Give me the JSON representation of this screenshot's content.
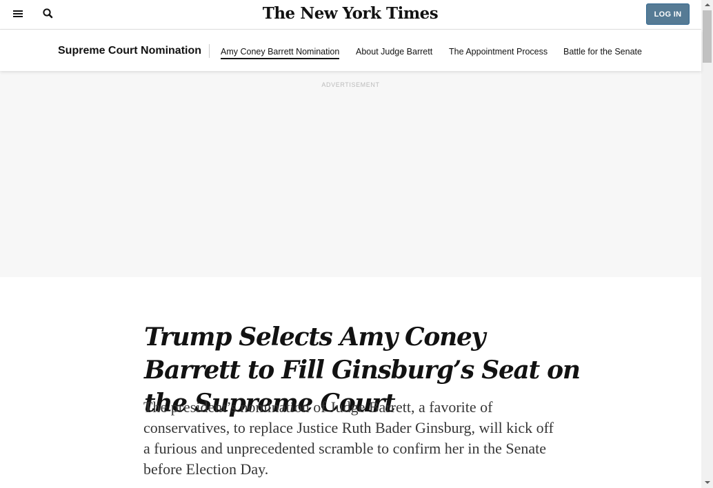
{
  "header": {
    "logo": "The New York Times",
    "login_label": "LOG IN",
    "menu_icon": "hamburger-menu-icon",
    "search_icon": "search-icon"
  },
  "section_nav": {
    "title": "Supreme Court Nomination",
    "links": [
      {
        "label": "Amy Coney Barrett Nomination",
        "active": true
      },
      {
        "label": "About Judge Barrett",
        "active": false
      },
      {
        "label": "The Appointment Process",
        "active": false
      },
      {
        "label": "Battle for the Senate",
        "active": false
      }
    ]
  },
  "ad": {
    "label": "ADVERTISEMENT"
  },
  "article": {
    "headline": "Trump Selects Amy Coney Barrett to Fill Ginsburg’s Seat on the Supreme Court",
    "summary": "The president’s nomination of Judge Barrett, a favorite of conservatives, to replace Justice Ruth Bader Ginsburg, will kick off a furious and unprecedented scramble to confirm her in the Senate before Election Day."
  },
  "colors": {
    "login_button": "#567b95",
    "ad_background": "#f7f7f7",
    "text": "#121212"
  }
}
